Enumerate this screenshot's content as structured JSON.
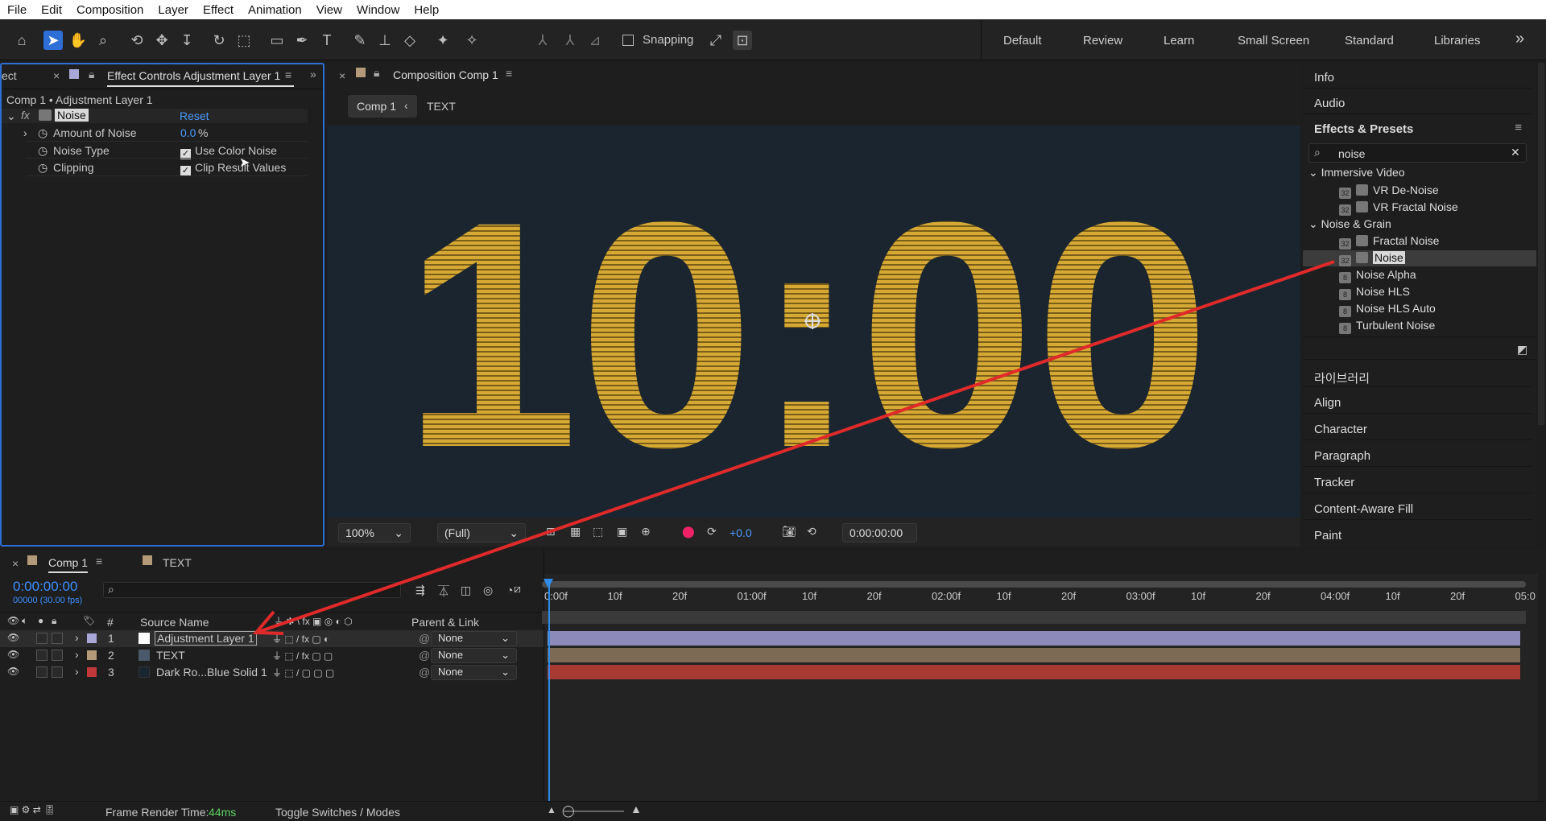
{
  "menu": [
    "File",
    "Edit",
    "Composition",
    "Layer",
    "Effect",
    "Animation",
    "View",
    "Window",
    "Help"
  ],
  "toolbar": {
    "snapping": "Snapping",
    "workspaces": [
      "Default",
      "Review",
      "Learn",
      "Small Screen",
      "Standard",
      "Libraries"
    ],
    "more": "»"
  },
  "effect_controls": {
    "partial_tab": "ect",
    "tab": "Effect Controls Adjustment Layer 1",
    "breadcrumb": "Comp 1 • Adjustment Layer 1",
    "effect": "Noise",
    "fx": "fx",
    "reset": "Reset",
    "amount_label": "Amount of Noise",
    "amount_value": "0.0",
    "amount_unit": "%",
    "type_label": "Noise Type",
    "type_option": "Use Color Noise",
    "clip_label": "Clipping",
    "clip_option": "Clip Result Values"
  },
  "composition": {
    "tab": "Composition Comp 1",
    "crumb1": "Comp 1",
    "crumb2": "TEXT",
    "display_text": "10:00",
    "zoom": "100%",
    "resolution": "(Full)",
    "exposure": "+0.0",
    "timecode": "0:00:00:00"
  },
  "right_panels": {
    "info": "Info",
    "audio": "Audio",
    "effects_presets": "Effects & Presets",
    "search_value": "noise",
    "groups": [
      {
        "name": "Immersive Video",
        "items": [
          "VR De-Noise",
          "VR Fractal Noise"
        ]
      },
      {
        "name": "Noise & Grain",
        "items": [
          "Fractal Noise",
          "Noise",
          "Noise Alpha",
          "Noise HLS",
          "Noise HLS Auto",
          "Turbulent Noise"
        ]
      }
    ],
    "lower": [
      "라이브러리",
      "Align",
      "Character",
      "Paragraph",
      "Tracker",
      "Content-Aware Fill",
      "Paint"
    ]
  },
  "timeline": {
    "tab1": "Comp 1",
    "tab2": "TEXT",
    "timecode": "0:00:00:00",
    "fps": "00000 (30.00 fps)",
    "col_source": "Source Name",
    "col_parent": "Parent & Link",
    "col_num": "#",
    "layers": [
      {
        "num": "1",
        "name": "Adjustment Layer 1",
        "parent": "None",
        "color": "#a9a7d6",
        "bar": "#8c8ab8"
      },
      {
        "num": "2",
        "name": "TEXT",
        "parent": "None",
        "color": "#b49a78",
        "bar": "#7c6a55"
      },
      {
        "num": "3",
        "name": "Dark Ro...Blue Solid 1",
        "parent": "None",
        "color": "#c2383a",
        "bar": "#a83a34"
      }
    ],
    "ruler": [
      "0:00f",
      "10f",
      "20f",
      "01:00f",
      "10f",
      "20f",
      "02:00f",
      "10f",
      "20f",
      "03:00f",
      "10f",
      "20f",
      "04:00f",
      "10f",
      "20f",
      "05:0"
    ],
    "render_label": "Frame Render Time:",
    "render_value": "44ms",
    "toggle": "Toggle Switches / Modes"
  },
  "colors": {
    "accent": "#2d8ceb",
    "annotation": "#e02a2a",
    "text_fill": "#d6a934",
    "comp_bg": "#1a2530"
  }
}
